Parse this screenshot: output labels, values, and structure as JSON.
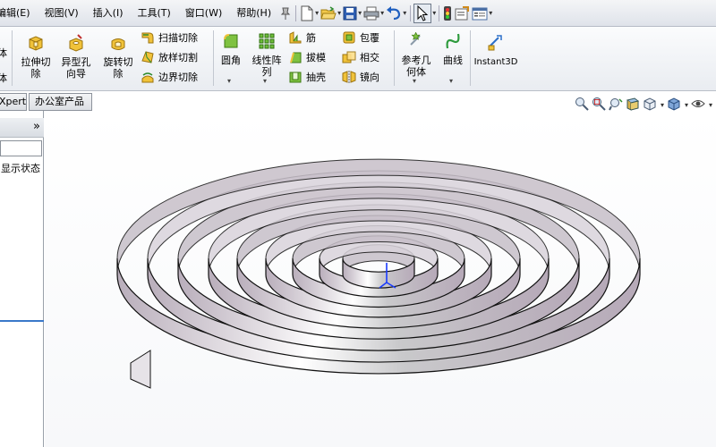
{
  "menu": {
    "items": [
      "编辑(E)",
      "视图(V)",
      "插入(I)",
      "工具(T)",
      "窗口(W)",
      "帮助(H)"
    ]
  },
  "toolbar": {
    "icons": [
      "pin-icon",
      "new-doc-icon",
      "open-folder-icon",
      "save-icon",
      "print-icon",
      "undo-icon",
      "select-arrow-icon",
      "traffic-light-icon",
      "options-icon",
      "properties-icon"
    ]
  },
  "ribbon": {
    "left_partial": [
      "体",
      "体"
    ],
    "extrude_cut": "拉伸切\n除",
    "hole_wizard": "异型孔\n向导",
    "revolve_cut": "旋转切\n除",
    "sweep_cut": "扫描切除",
    "loft_cut": "放样切割",
    "boundary_cut": "边界切除",
    "fillet": "圆角",
    "linear_pattern": "线性阵\n列",
    "rib": "筋",
    "draft": "拔模",
    "shell": "抽壳",
    "wrap": "包覆",
    "intersect": "相交",
    "mirror": "镜向",
    "ref_geometry": "参考几\n何体",
    "curves": "曲线",
    "instant3d": "Instant3D"
  },
  "tabs": [
    "Xpert",
    "办公室产品"
  ],
  "left_panel": {
    "expand_label": "»",
    "display_state": "显示状态"
  },
  "view_toolbar": {
    "icons": [
      "zoom-to-fit-icon",
      "zoom-area-icon",
      "previous-view-icon",
      "section-view-icon",
      "view-orientation-icon",
      "display-style-icon",
      "hide-show-icon"
    ]
  },
  "colors": {
    "spiral_face": "#b9aebb",
    "spiral_edge": "#111111",
    "ribbon_bg": "#eef0f4"
  }
}
